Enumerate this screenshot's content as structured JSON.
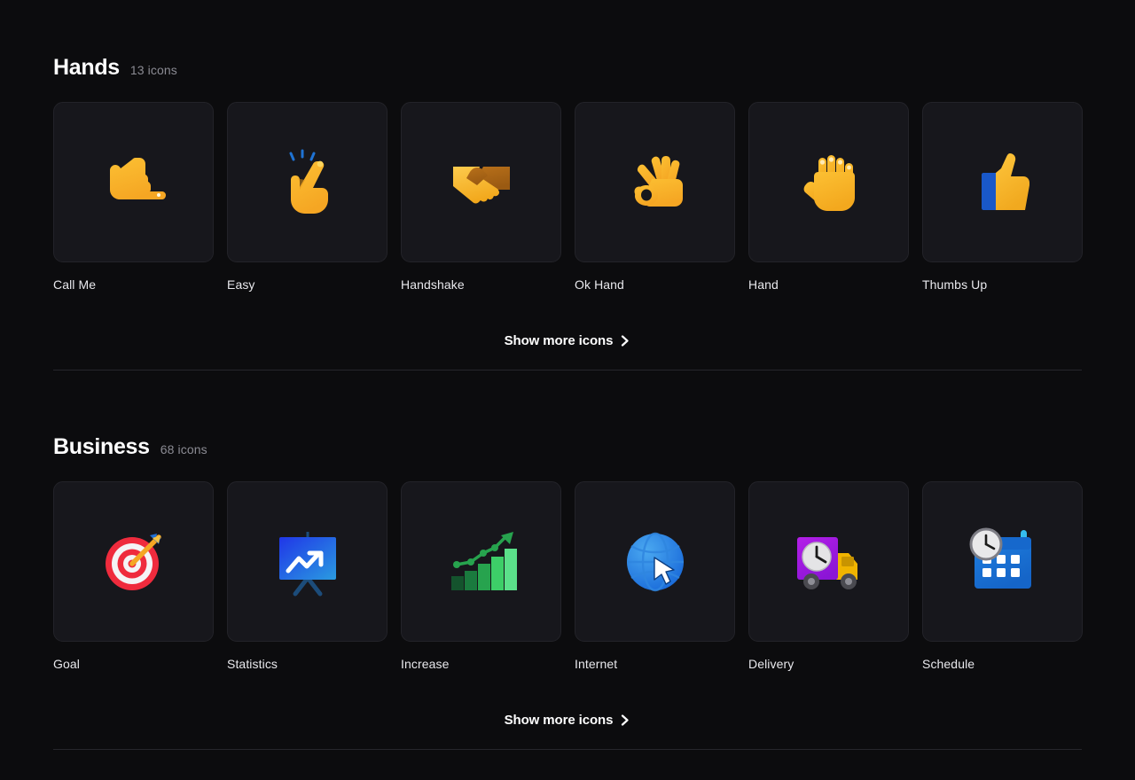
{
  "theme": {
    "background": "#0c0c0e",
    "card_background": "#17171c",
    "card_border": "#232329",
    "text_primary": "#ffffff",
    "text_secondary": "#8b8b93",
    "divider": "#26262c"
  },
  "sections": [
    {
      "title": "Hands",
      "count_label": "13 icons",
      "show_more_label": "Show more icons",
      "chevron_icon": "chevron-right-icon",
      "icons": [
        {
          "label": "Call Me",
          "icon_name": "call-me-icon"
        },
        {
          "label": "Easy",
          "icon_name": "easy-snap-fingers-icon"
        },
        {
          "label": "Handshake",
          "icon_name": "handshake-icon"
        },
        {
          "label": "Ok Hand",
          "icon_name": "ok-hand-icon"
        },
        {
          "label": "Hand",
          "icon_name": "open-hand-icon"
        },
        {
          "label": "Thumbs Up",
          "icon_name": "thumbs-up-icon"
        }
      ]
    },
    {
      "title": "Business",
      "count_label": "68 icons",
      "show_more_label": "Show more icons",
      "chevron_icon": "chevron-right-icon",
      "icons": [
        {
          "label": "Goal",
          "icon_name": "target-goal-icon"
        },
        {
          "label": "Statistics",
          "icon_name": "statistics-board-icon"
        },
        {
          "label": "Increase",
          "icon_name": "increase-bar-chart-icon"
        },
        {
          "label": "Internet",
          "icon_name": "globe-cursor-icon"
        },
        {
          "label": "Delivery",
          "icon_name": "delivery-truck-icon"
        },
        {
          "label": "Schedule",
          "icon_name": "calendar-clock-icon"
        }
      ]
    }
  ]
}
